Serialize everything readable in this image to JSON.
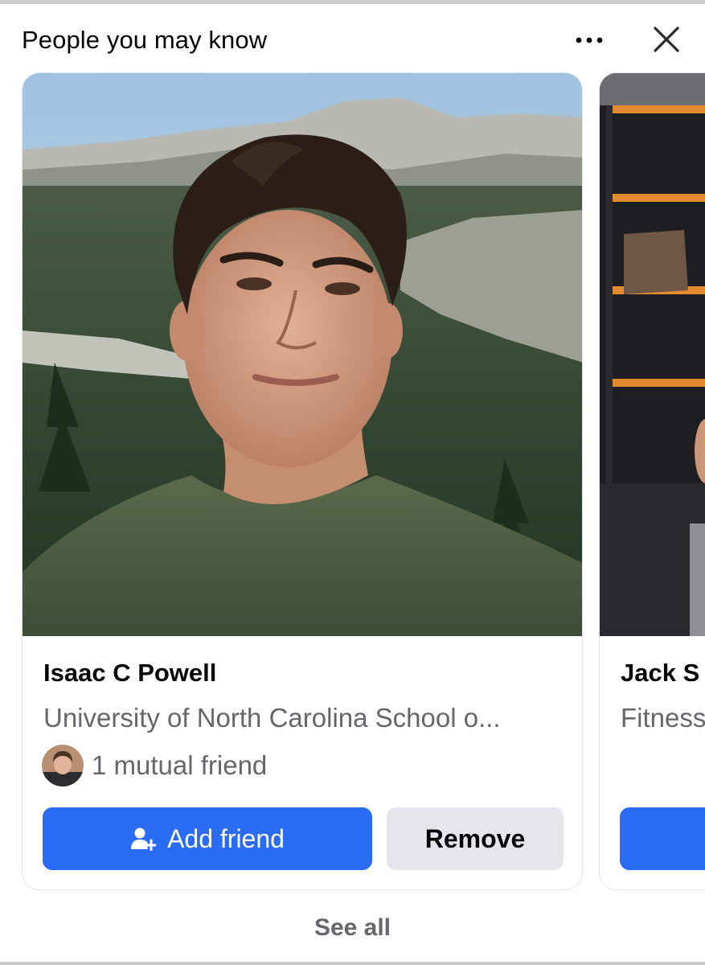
{
  "header": {
    "title": "People you may know",
    "more_icon": "more-horizontal-icon",
    "close_icon": "close-icon"
  },
  "suggestions": [
    {
      "name": "Isaac C Powell",
      "subtitle": "University of North Carolina School o...",
      "mutual_friends": "1 mutual friend",
      "add_label": "Add friend",
      "remove_label": "Remove",
      "add_icon": "add-person-icon"
    },
    {
      "name": "Jack S",
      "subtitle": "Fitness"
    }
  ],
  "footer": {
    "see_all": "See all"
  },
  "colors": {
    "primary": "#2a6df4",
    "secondary_button": "#e4e6eb",
    "muted_text": "#65676b",
    "text": "#050505"
  }
}
